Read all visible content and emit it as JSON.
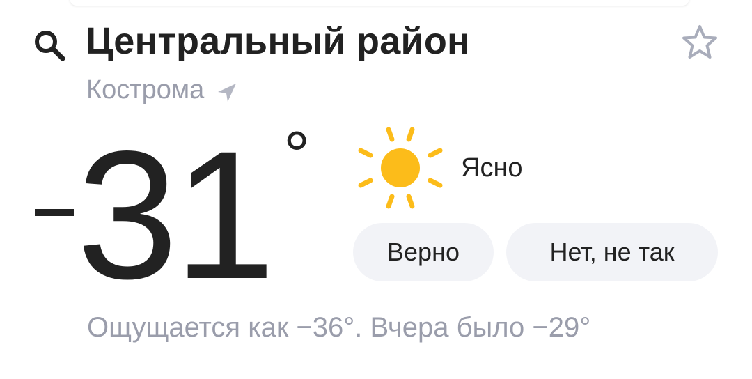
{
  "header": {
    "title": "Центральный район",
    "city": "Кострома",
    "icons": {
      "search": "search-icon",
      "favorite": "star-icon",
      "location": "navigation-arrow-icon"
    }
  },
  "current": {
    "temperature_value": "31",
    "temperature_sign": "−",
    "degree": "°",
    "condition": "Ясно",
    "condition_icon": "sun-icon"
  },
  "feedback": {
    "yes_label": "Верно",
    "no_label": "Нет, не так"
  },
  "details": {
    "feels_like_text": "Ощущается как −36°. Вчера было −29°"
  },
  "colors": {
    "text_primary": "#222222",
    "text_secondary": "#9a9dab",
    "button_bg": "#f2f3f7",
    "sun": "#fcbc1a",
    "star": "#a9adbb"
  }
}
